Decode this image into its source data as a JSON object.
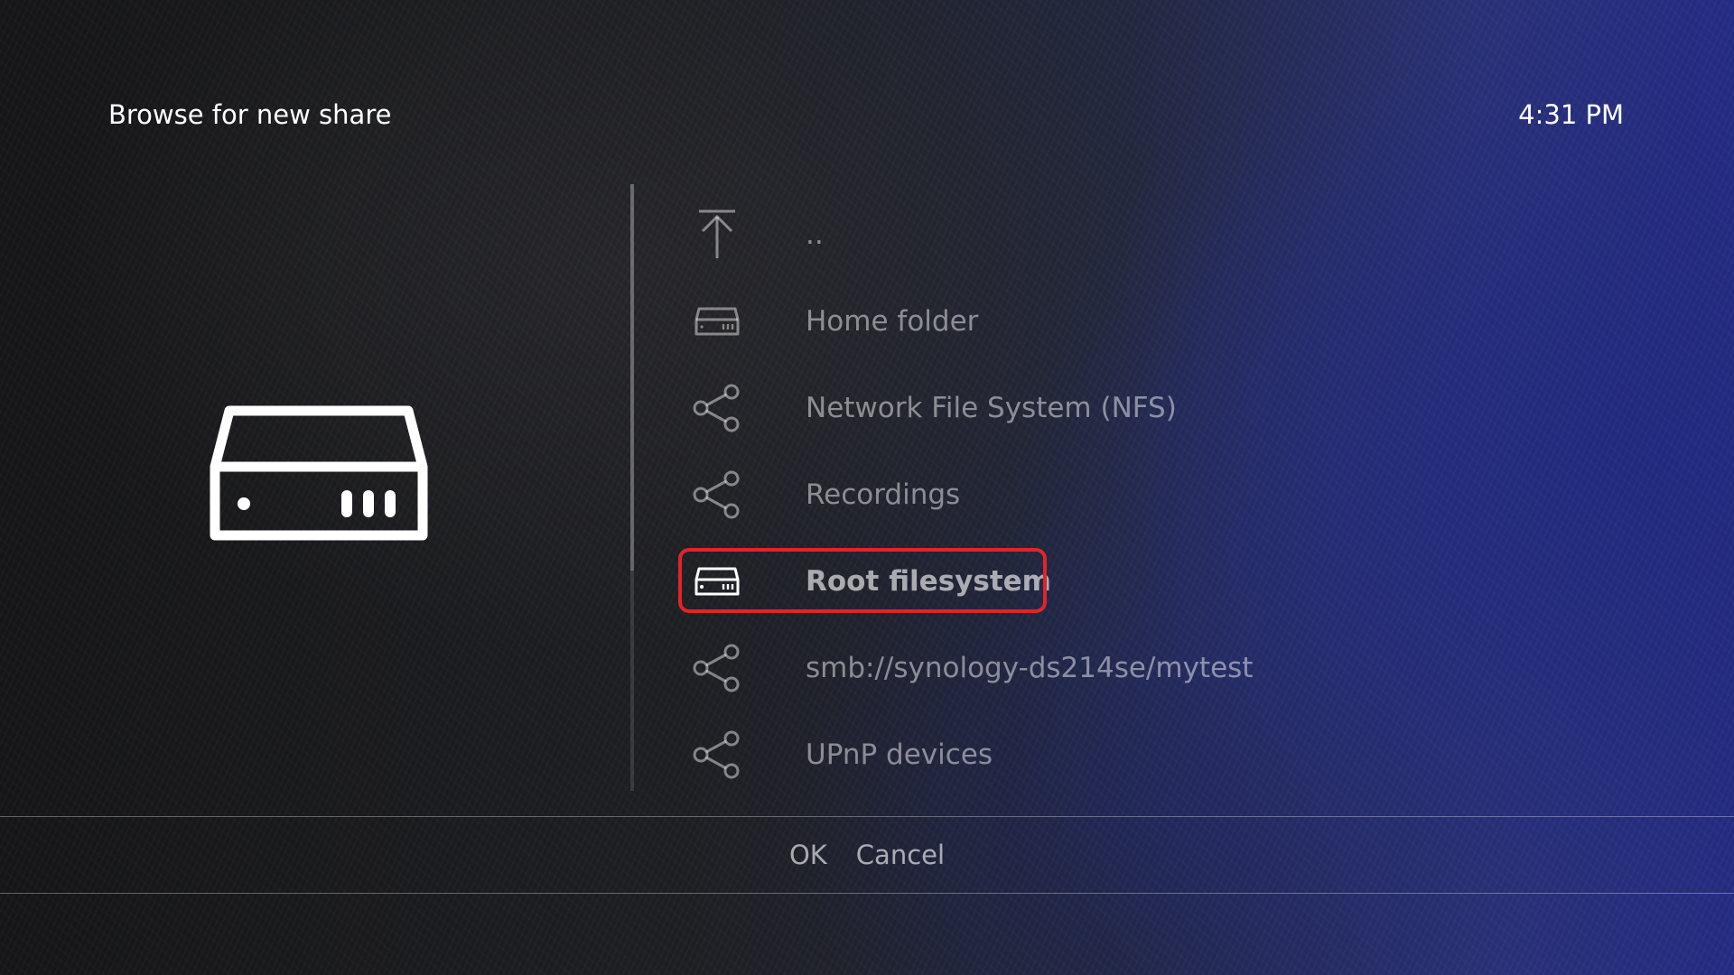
{
  "header": {
    "title": "Browse for new share",
    "clock": "4:31 PM"
  },
  "thumbnail": {
    "icon": "harddisk-icon"
  },
  "list": {
    "items": [
      {
        "label": "..",
        "icon": "parent-folder-icon"
      },
      {
        "label": "Home folder",
        "icon": "harddisk-icon"
      },
      {
        "label": "Network File System (NFS)",
        "icon": "share-icon"
      },
      {
        "label": "Recordings",
        "icon": "share-icon"
      },
      {
        "label": "Root filesystem",
        "icon": "harddisk-icon",
        "focused": true
      },
      {
        "label": "smb://synology-ds214se/mytest",
        "icon": "share-icon"
      },
      {
        "label": "UPnP devices",
        "icon": "share-icon"
      }
    ]
  },
  "buttons": {
    "ok": "OK",
    "cancel": "Cancel"
  },
  "colors": {
    "focus_outline": "#e0242b"
  }
}
